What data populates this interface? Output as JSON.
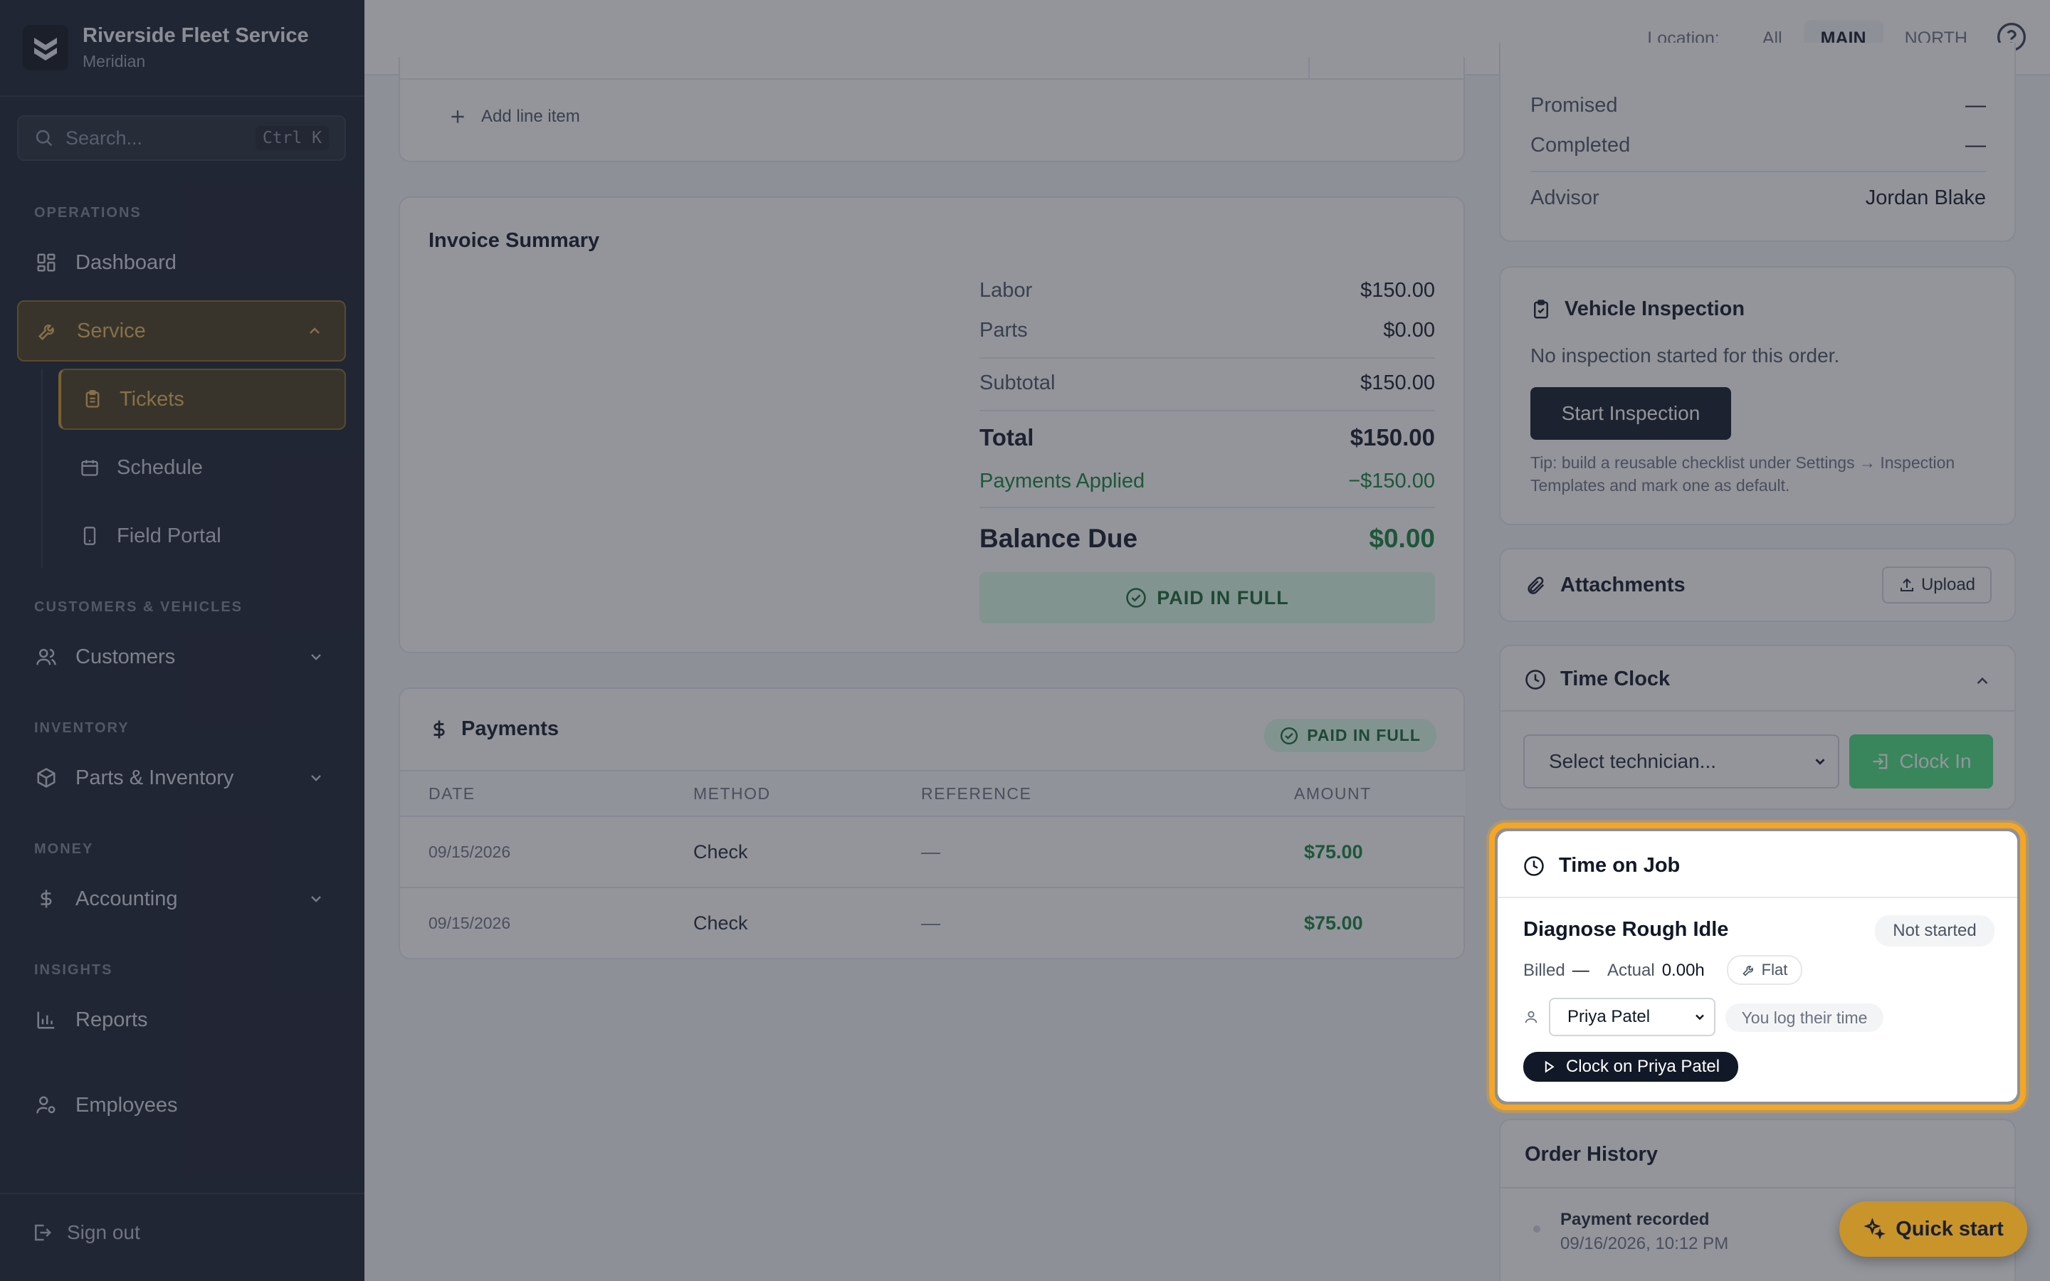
{
  "brand": {
    "name": "Riverside Fleet Service",
    "sub": "Meridian"
  },
  "search": {
    "placeholder": "Search...",
    "shortcut": "Ctrl K"
  },
  "sidebar": {
    "sections": {
      "operations": "OPERATIONS",
      "customers": "CUSTOMERS & VEHICLES",
      "inventory": "INVENTORY",
      "money": "MONEY",
      "insights": "INSIGHTS"
    },
    "items": {
      "dashboard": "Dashboard",
      "service": "Service",
      "tickets": "Tickets",
      "schedule": "Schedule",
      "field_portal": "Field Portal",
      "customers": "Customers",
      "parts": "Parts & Inventory",
      "accounting": "Accounting",
      "reports": "Reports",
      "employees": "Employees"
    },
    "signout": "Sign out"
  },
  "topbar": {
    "location_label": "Location:",
    "locations": [
      "All",
      "MAIN",
      "NORTH"
    ],
    "active_location": "MAIN"
  },
  "line_items": {
    "add_label": "Add line item"
  },
  "invoice": {
    "title": "Invoice Summary",
    "labor_label": "Labor",
    "labor": "$150.00",
    "parts_label": "Parts",
    "parts": "$0.00",
    "subtotal_label": "Subtotal",
    "subtotal": "$150.00",
    "total_label": "Total",
    "total": "$150.00",
    "payments_label": "Payments Applied",
    "payments": "−$150.00",
    "balance_label": "Balance Due",
    "balance": "$0.00",
    "status": "PAID IN FULL"
  },
  "payments": {
    "title": "Payments",
    "badge": "PAID IN FULL",
    "columns": [
      "DATE",
      "METHOD",
      "REFERENCE",
      "AMOUNT"
    ],
    "rows": [
      {
        "date": "09/15/2026",
        "method": "Check",
        "reference": "—",
        "amount": "$75.00"
      },
      {
        "date": "09/15/2026",
        "method": "Check",
        "reference": "—",
        "amount": "$75.00"
      }
    ]
  },
  "order_info": {
    "promised_label": "Promised",
    "promised": "—",
    "completed_label": "Completed",
    "completed": "—",
    "advisor_label": "Advisor",
    "advisor": "Jordan Blake"
  },
  "inspection": {
    "title": "Vehicle Inspection",
    "empty": "No inspection started for this order.",
    "button": "Start Inspection",
    "tip": "Tip: build a reusable checklist under Settings → Inspection Templates and mark one as default."
  },
  "attachments": {
    "title": "Attachments",
    "upload": "Upload"
  },
  "time_clock": {
    "title": "Time Clock",
    "select_placeholder": "Select technician...",
    "clock_in": "Clock In"
  },
  "time_on_job": {
    "title": "Time on Job",
    "job_name": "Diagnose Rough Idle",
    "status": "Not started",
    "billed_label": "Billed",
    "billed": "—",
    "actual_label": "Actual",
    "actual": "0.00h",
    "rate_type": "Flat",
    "technician": "Priya Patel",
    "log_note": "You log their time",
    "clock_on_button": "Clock on Priya Patel"
  },
  "history": {
    "title": "Order History",
    "entries": [
      {
        "event": "Payment recorded",
        "time": "09/16/2026, 10:12 PM"
      }
    ]
  },
  "quick_start": "Quick start"
}
